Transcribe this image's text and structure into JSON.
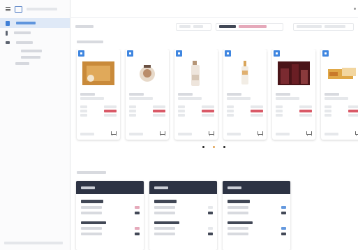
{
  "colors": {
    "accent": "#3f7fd6",
    "nav_active_bg": "#dfe9f7",
    "panel_header": "#2d3344",
    "price_red": "#d23c4c",
    "pager_active": "#e0a050"
  },
  "header": {
    "title": ""
  },
  "sidebar": {
    "items": [
      {
        "label": "",
        "icon": "catalog-icon"
      },
      {
        "label": "",
        "icon": "person-icon"
      },
      {
        "label": "",
        "icon": "link-icon"
      }
    ],
    "subitems": [
      "",
      "",
      ""
    ],
    "footer": ""
  },
  "toolbar": {
    "title": "",
    "filters": [
      {
        "left": "",
        "right": ""
      },
      {
        "left": "",
        "right": ""
      },
      {
        "left": "",
        "right": ""
      }
    ]
  },
  "products": {
    "label": "",
    "cards": [
      {
        "name": "",
        "sub": "",
        "r1k": "",
        "r1v": "",
        "r2k": "",
        "r2v": "",
        "r3k": "",
        "r3v": "",
        "foot": ""
      },
      {
        "name": "",
        "sub": "",
        "r1k": "",
        "r1v": "",
        "r2k": "",
        "r2v": "",
        "r3k": "",
        "r3v": "",
        "foot": ""
      },
      {
        "name": "",
        "sub": "",
        "r1k": "",
        "r1v": "",
        "r2k": "",
        "r2v": "",
        "r3k": "",
        "r3v": "",
        "foot": ""
      },
      {
        "name": "",
        "sub": "",
        "r1k": "",
        "r1v": "",
        "r2k": "",
        "r2v": "",
        "r3k": "",
        "r3v": "",
        "foot": ""
      },
      {
        "name": "",
        "sub": "",
        "r1k": "",
        "r1v": "",
        "r2k": "",
        "r2v": "",
        "r3k": "",
        "r3v": "",
        "foot": ""
      },
      {
        "name": "",
        "sub": "",
        "r1k": "",
        "r1v": "",
        "r2k": "",
        "r2v": "",
        "r3k": "",
        "r3v": "",
        "foot": ""
      }
    ],
    "pages": 3,
    "active_page": 2
  },
  "summary": {
    "label": "",
    "panels": [
      {
        "header": "",
        "title": "",
        "rows": [
          {
            "a": "",
            "b": ""
          },
          {
            "a": "",
            "b": ""
          }
        ],
        "sec": "",
        "rows2": [
          {
            "a": "",
            "b": ""
          },
          {
            "a": "",
            "b": ""
          }
        ]
      },
      {
        "header": "",
        "title": "",
        "rows": [
          {
            "a": "",
            "b": ""
          },
          {
            "a": "",
            "b": ""
          }
        ],
        "sec": "",
        "rows2": [
          {
            "a": "",
            "b": ""
          },
          {
            "a": "",
            "b": ""
          }
        ]
      },
      {
        "header": "",
        "title": "",
        "rows": [
          {
            "a": "",
            "b": ""
          },
          {
            "a": "",
            "b": ""
          }
        ],
        "sec": "",
        "rows2": [
          {
            "a": "",
            "b": ""
          },
          {
            "a": "",
            "b": ""
          }
        ]
      }
    ]
  }
}
